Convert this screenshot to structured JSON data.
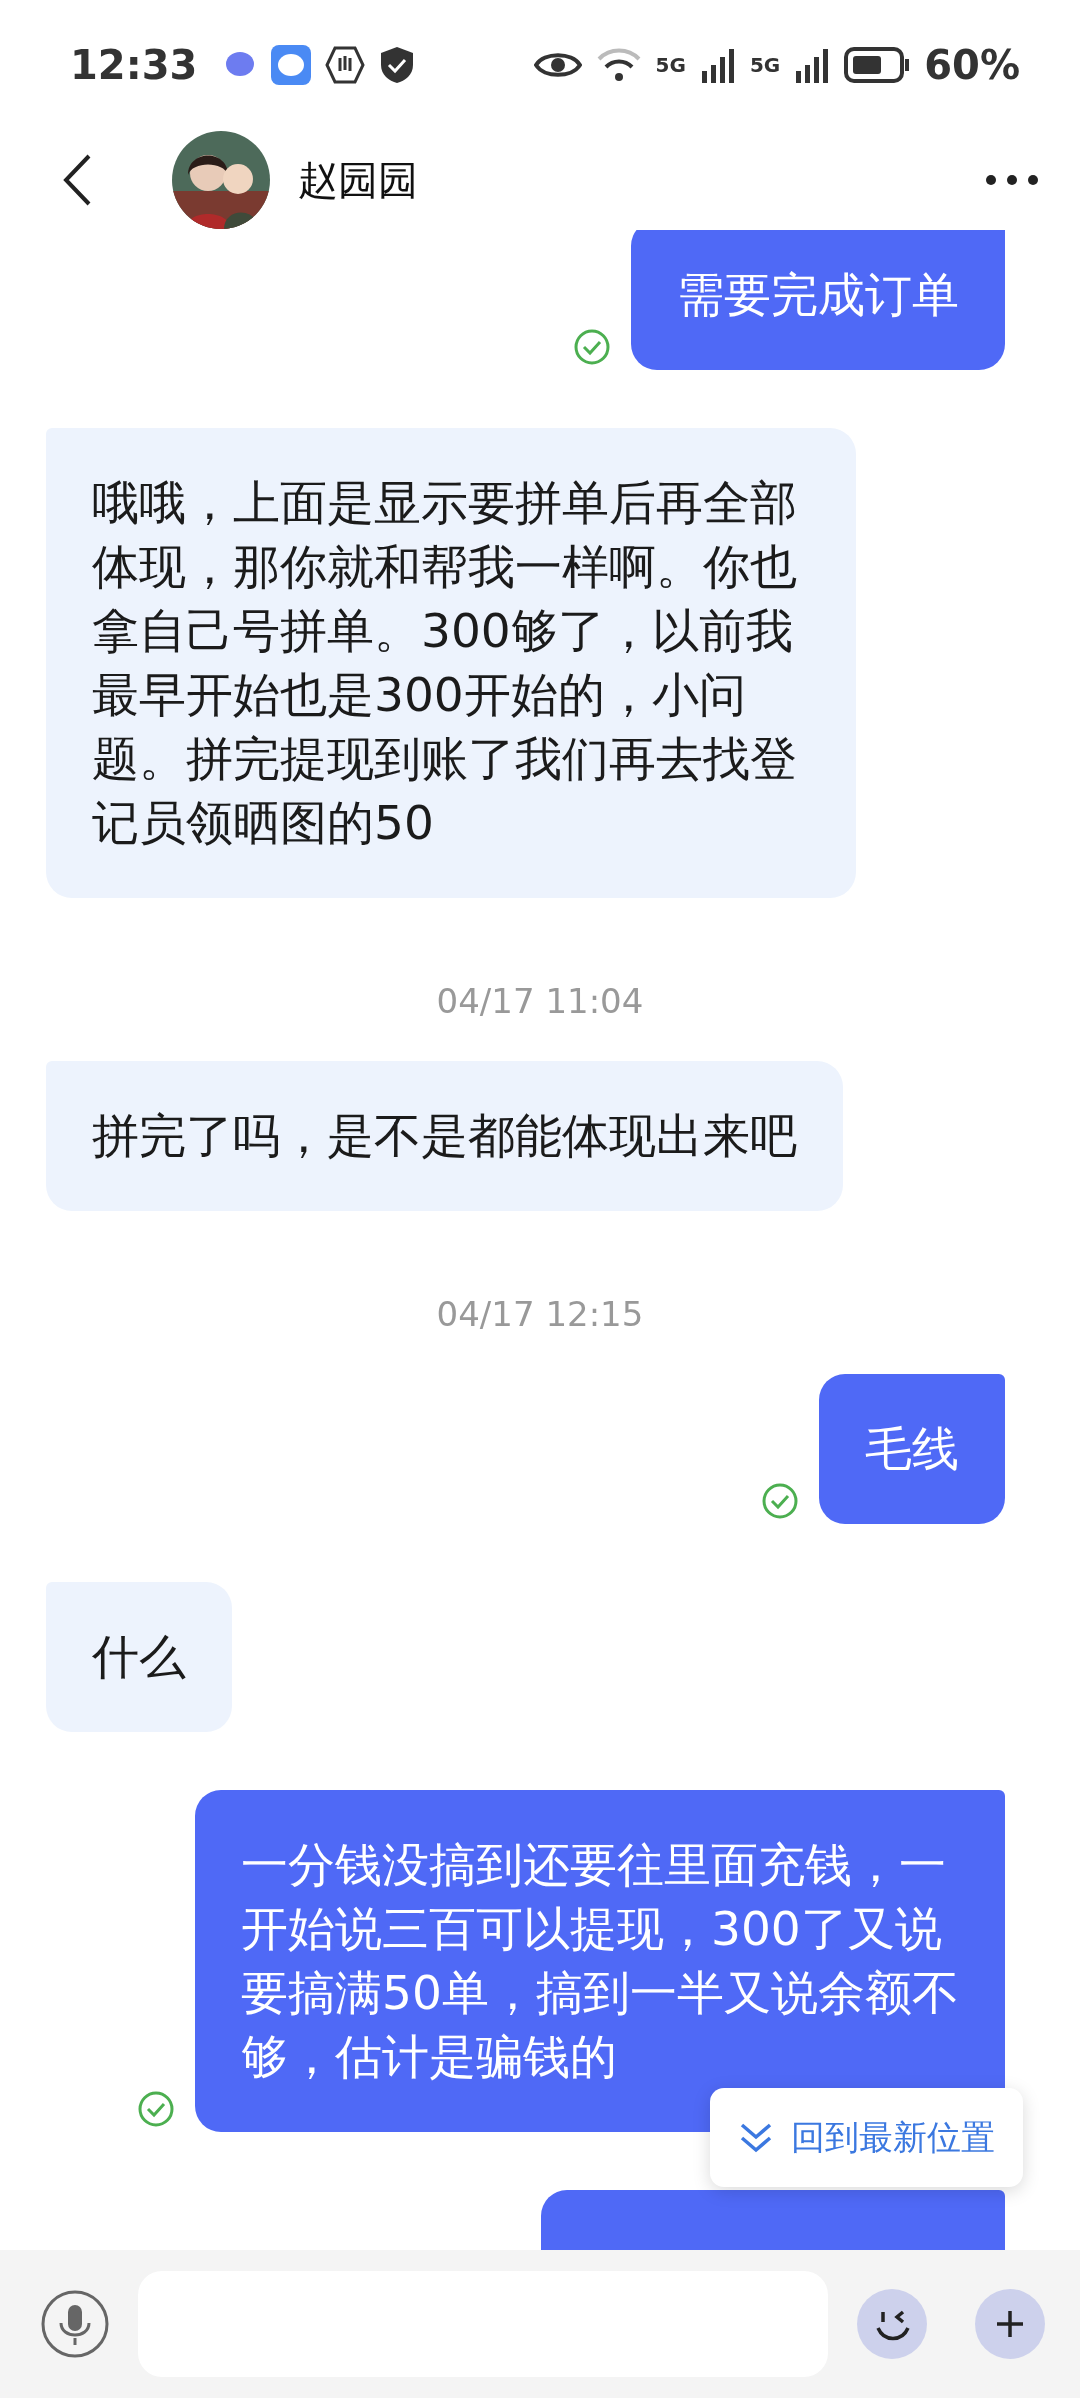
{
  "status_bar": {
    "time": "12:33",
    "network_1": "5G",
    "network_2": "5G",
    "battery": "60%"
  },
  "header": {
    "contact_name": "赵园园"
  },
  "messages": [
    {
      "kind": "outgoing",
      "text": "需要完成订单",
      "delivered": true
    },
    {
      "kind": "incoming",
      "text": "哦哦，上面是显示要拼单后再全部体现，那你就和帮我一样啊。你也拿自己号拼单。300够了，以前我最早开始也是300开始的，小问题。拼完提现到账了我们再去找登记员领晒图的50"
    },
    {
      "kind": "timestamp",
      "text": "04/17 11:04"
    },
    {
      "kind": "incoming",
      "text": "拼完了吗，是不是都能体现出来吧"
    },
    {
      "kind": "timestamp",
      "text": "04/17 12:15"
    },
    {
      "kind": "outgoing",
      "text": "毛线",
      "delivered": true
    },
    {
      "kind": "incoming",
      "text": "什么"
    },
    {
      "kind": "outgoing",
      "text": "一分钱没搞到还要往里面充钱，一开始说三百可以提现，300了又说要搞满50单，搞到一半又说余额不够，估计是骗钱的",
      "delivered": true
    },
    {
      "kind": "outgoing"
    }
  ],
  "jump_button": {
    "label": "回到最新位置"
  }
}
